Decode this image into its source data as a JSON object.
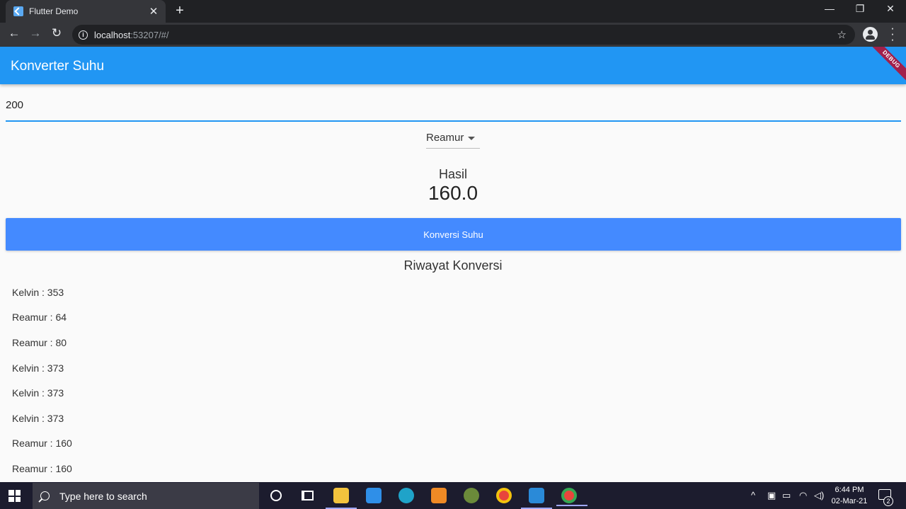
{
  "browser": {
    "tab_title": "Flutter Demo",
    "tab_close": "✕",
    "new_tab": "+",
    "url_host": "localhost",
    "url_rest": ":53207/#/",
    "icons": [
      "flutter-favicon",
      "back-arrow-icon",
      "forward-arrow-icon",
      "reload-icon",
      "info-icon",
      "star-icon",
      "account-icon",
      "more-vert-icon"
    ]
  },
  "app": {
    "title": "Konverter Suhu",
    "debug_banner": "DEBUG",
    "input_value": "200",
    "dropdown_selected": "Reamur",
    "result_label": "Hasil",
    "result_value": "160.0",
    "convert_button": "Konversi Suhu",
    "history_title": "Riwayat Konversi",
    "history": [
      "Kelvin : 353",
      "Reamur : 64",
      "Reamur : 80",
      "Kelvin : 373",
      "Kelvin : 373",
      "Kelvin : 373",
      "Reamur : 160",
      "Reamur : 160"
    ],
    "colors": {
      "primary": "#2196f3",
      "button": "#448aff",
      "debug": "#a2204b"
    }
  },
  "taskbar": {
    "search_placeholder": "Type here to search",
    "time": "6:44 PM",
    "date": "02-Mar-21",
    "notification_count": "2",
    "apps": [
      "file-explorer-icon",
      "mail-icon",
      "edge-icon",
      "sublime-text-icon",
      "game-app-icon",
      "chrome-icon",
      "vscode-icon",
      "chrome-icon-active"
    ]
  }
}
